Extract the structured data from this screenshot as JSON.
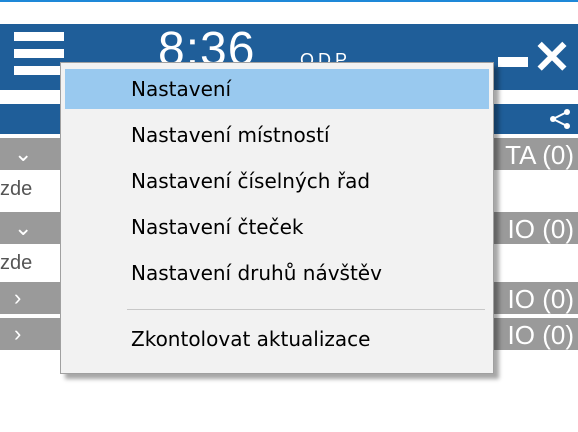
{
  "window": {
    "time": "8:36",
    "ampm": "ODP"
  },
  "sections": [
    {
      "suffix": "TA (0)",
      "row": "zde"
    },
    {
      "suffix": "IO (0)",
      "row": "zde"
    },
    {
      "suffix": "IO (0)"
    },
    {
      "suffix": "IO (0)"
    }
  ],
  "menu": {
    "items": [
      {
        "label": "Nastavení"
      },
      {
        "label": "Nastavení místností"
      },
      {
        "label": "Nastavení číselných řad"
      },
      {
        "label": "Nastavení čteček"
      },
      {
        "label": "Nastavení druhů návštěv"
      },
      {
        "label": "Zkontolovat aktualizace"
      }
    ],
    "selected_index": 0
  },
  "colors": {
    "titlebar": "#1f5e99",
    "section": "#9a9a9a",
    "selection": "#99c9ef"
  }
}
